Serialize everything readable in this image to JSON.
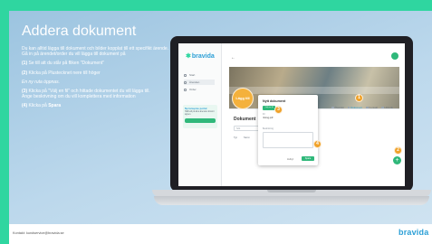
{
  "slide": {
    "title": "Addera dokument",
    "intro_1": "Du kan alltid lägga till dokument och bilder kopplat till ett specifikt ärende.",
    "intro_2": "Gå in på ärendet/order du vill lägga till dokument på",
    "step1_num": "(1)",
    "step1_text": " Se till att du står på fliken \"Dokument\"",
    "step2_num": "(2)",
    "step2_text": " Klicka på Plustecknet nere till höger",
    "info": "En ny ruta öppnas.",
    "step3_num": "(3)",
    "step3_text": " Klicka på \"Välj en fil\" och hittade dokumentet du vill lägga till.",
    "step3_sub": "Ange beskrivning om du vill komplettera med information",
    "step4_num": "(4)",
    "step4_text": " Klicka på ",
    "step4_bold": "Spara"
  },
  "app": {
    "brand": "bravida",
    "nav": [
      "Start",
      "Ärenden",
      "Order"
    ],
    "promo_title": "Nu lanseras portal",
    "promo_text": "Håll koll på dina ärenden direkt i appen.",
    "tabs": [
      "Översikt",
      "Dokument",
      "Kontakt",
      "Historik"
    ],
    "doc_title": "Dokument",
    "search_placeholder": "Sök",
    "doc_cols": [
      "Typ",
      "Namn"
    ],
    "fab": "+",
    "modal": {
      "title": "Nytt dokument",
      "pick_file": "Välj en fil",
      "file_label": "Fil",
      "file_name": "ritning.pdf",
      "desc_label": "Beskrivning",
      "cancel": "Avbryt",
      "save": "Spara"
    },
    "markers": {
      "m1": "1",
      "m2": "2",
      "m3": "3",
      "m4": "4",
      "big": "Lägg till"
    }
  },
  "footer": {
    "contact": "Kontakt: kundservice@bravida.se",
    "logo": "bravida"
  },
  "colors": {
    "accent": "#2fd6a0",
    "brand_blue": "#2b9fd6",
    "marker": "#f0a22a",
    "save_green": "#2fb87a"
  }
}
